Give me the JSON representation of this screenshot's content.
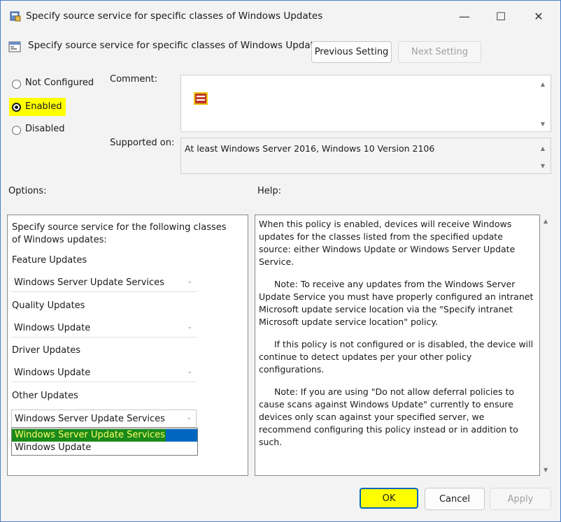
{
  "window": {
    "title": "Specify source service for specific classes of Windows Updates",
    "minimize_glyph": "—",
    "maximize_glyph": "☐",
    "close_glyph": "✕"
  },
  "header": {
    "policy_title": "Specify source service for specific classes of Windows Updates",
    "prev_label": "Previous Setting",
    "next_label": "Next Setting"
  },
  "state": {
    "not_configured": "Not Configured",
    "enabled": "Enabled",
    "disabled": "Disabled",
    "selected": "enabled"
  },
  "comment": {
    "label": "Comment:",
    "value": ""
  },
  "supported": {
    "label": "Supported on:",
    "value": "At least Windows Server 2016, Windows 10 Version 2106"
  },
  "options": {
    "label": "Options:",
    "intro": "Specify source service for the following classes of Windows updates:",
    "feature": {
      "label": "Feature Updates",
      "value": "Windows Server Update Services"
    },
    "quality": {
      "label": "Quality Updates",
      "value": "Windows Update"
    },
    "driver": {
      "label": "Driver Updates",
      "value": "Windows Update"
    },
    "other": {
      "label": "Other Updates",
      "value": "Windows Server Update Services"
    },
    "dropdown_items": [
      "Windows Server Update Services",
      "Windows Update"
    ]
  },
  "help": {
    "label": "Help:",
    "paragraphs": [
      "When this policy is enabled, devices will receive Windows updates for the classes listed from the specified update source: either Windows Update or Windows Server Update Service.",
      "Note: To receive any updates from the Windows Server Update Service you must have properly configured an intranet Microsoft update service location via the \"Specify intranet Microsoft update service location\" policy.",
      "If this policy is not configured or is disabled, the device will continue to detect updates per your other policy configurations.",
      "Note: If you are using \"Do not allow deferral policies to cause scans against Windows Update\" currently to ensure devices only scan against your specified server, we recommend configuring this policy instead or in addition to such."
    ]
  },
  "buttons": {
    "ok": "OK",
    "cancel": "Cancel",
    "apply": "Apply"
  },
  "colors": {
    "highlight_yellow": "#ffff00",
    "selection_green": "#00a000",
    "selection_blue": "#0067c0"
  }
}
